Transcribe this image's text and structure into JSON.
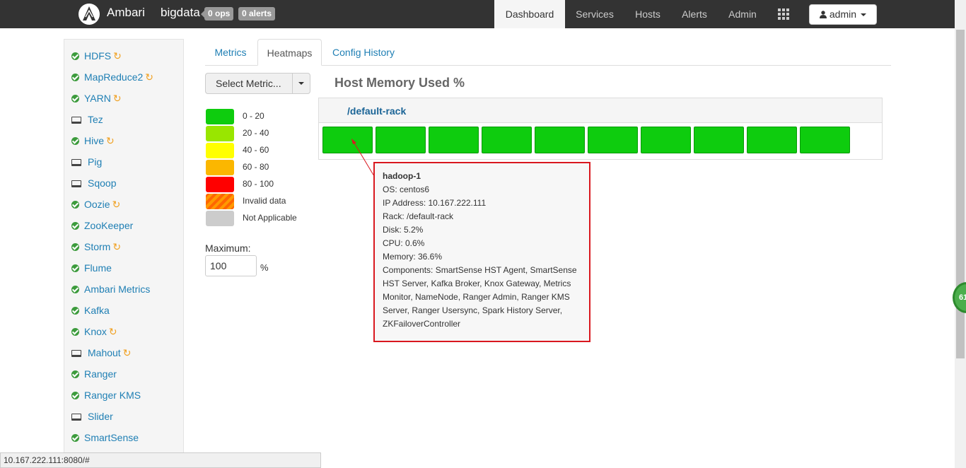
{
  "app": {
    "brand": "Ambari",
    "cluster": "bigdata",
    "ops_badge": "0 ops",
    "alerts_badge": "0 alerts"
  },
  "nav": {
    "items": [
      {
        "label": "Dashboard",
        "active": true
      },
      {
        "label": "Services",
        "active": false
      },
      {
        "label": "Hosts",
        "active": false
      },
      {
        "label": "Alerts",
        "active": false
      },
      {
        "label": "Admin",
        "active": false
      }
    ],
    "grid_icon": "grid-icon",
    "user_label": "admin"
  },
  "sidebar": {
    "services": [
      {
        "label": "HDFS",
        "status": "ok",
        "refresh": true
      },
      {
        "label": "MapReduce2",
        "status": "ok",
        "refresh": true
      },
      {
        "label": "YARN",
        "status": "ok",
        "refresh": true
      },
      {
        "label": "Tez",
        "status": "client",
        "refresh": false
      },
      {
        "label": "Hive",
        "status": "ok",
        "refresh": true
      },
      {
        "label": "Pig",
        "status": "client",
        "refresh": false
      },
      {
        "label": "Sqoop",
        "status": "client",
        "refresh": false
      },
      {
        "label": "Oozie",
        "status": "ok",
        "refresh": true
      },
      {
        "label": "ZooKeeper",
        "status": "ok",
        "refresh": false
      },
      {
        "label": "Storm",
        "status": "ok",
        "refresh": true
      },
      {
        "label": "Flume",
        "status": "ok",
        "refresh": false
      },
      {
        "label": "Ambari Metrics",
        "status": "ok",
        "refresh": false
      },
      {
        "label": "Kafka",
        "status": "ok",
        "refresh": false
      },
      {
        "label": "Knox",
        "status": "ok",
        "refresh": true
      },
      {
        "label": "Mahout",
        "status": "client",
        "refresh": true
      },
      {
        "label": "Ranger",
        "status": "ok",
        "refresh": false
      },
      {
        "label": "Ranger KMS",
        "status": "ok",
        "refresh": false
      },
      {
        "label": "Slider",
        "status": "client",
        "refresh": false
      },
      {
        "label": "SmartSense",
        "status": "ok",
        "refresh": false
      }
    ]
  },
  "tabs": [
    {
      "label": "Metrics",
      "active": false
    },
    {
      "label": "Heatmaps",
      "active": true
    },
    {
      "label": "Config History",
      "active": false
    }
  ],
  "metric_select": {
    "label": "Select Metric..."
  },
  "legend": [
    {
      "label": "0 - 20",
      "color": "#0ecc0e"
    },
    {
      "label": "20 - 40",
      "color": "#99e600"
    },
    {
      "label": "40 - 60",
      "color": "#ffff00"
    },
    {
      "label": "60 - 80",
      "color": "#fbb700"
    },
    {
      "label": "80 - 100",
      "color": "#ff0000"
    },
    {
      "label": "Invalid data",
      "color": "#ff6600"
    },
    {
      "label": "Not Applicable",
      "color": "#cccccc"
    }
  ],
  "maximum": {
    "label": "Maximum:",
    "value": "100",
    "unit": "%"
  },
  "heatmap": {
    "title": "Host Memory Used %",
    "rack": "/default-rack",
    "host_count": 10,
    "host_color": "#0ecc0e"
  },
  "tooltip": {
    "host": "hadoop-1",
    "os": "OS: centos6",
    "ip": "IP Address: 10.167.222.111",
    "rack": "Rack: /default-rack",
    "disk": "Disk: 5.2%",
    "cpu": "CPU: 0.6%",
    "memory": "Memory: 36.6%",
    "components": "Components: SmartSense HST Agent, SmartSense HST Server, Kafka Broker, Knox Gateway, Metrics Monitor, NameNode, Ranger Admin, Ranger KMS Server, Ranger Usersync, Spark History Server, ZKFailoverController"
  },
  "floating_badge": "61",
  "statusbar": {
    "url": "10.167.222.111:8080/#"
  }
}
